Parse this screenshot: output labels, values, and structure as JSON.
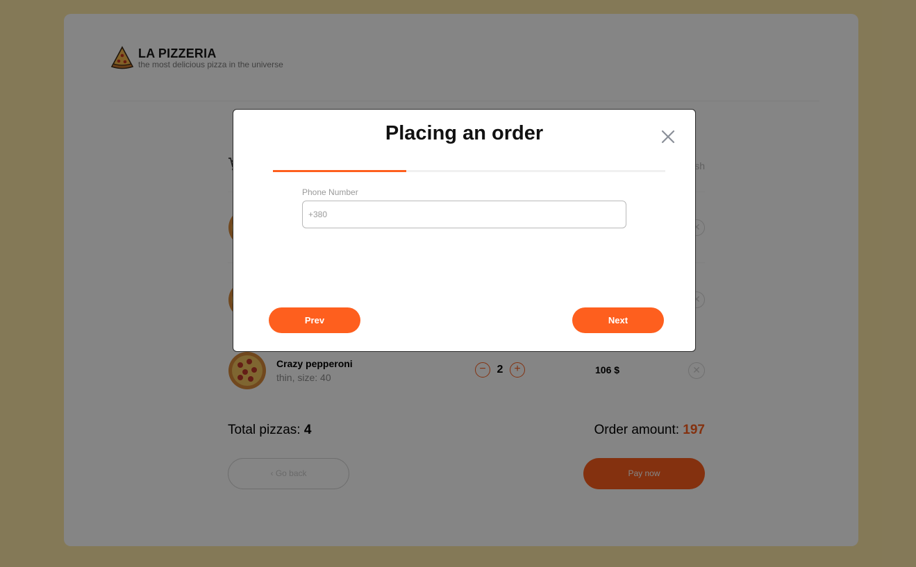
{
  "header": {
    "title": "LA PIZZERIA",
    "subtitle": "the most delicious pizza in the universe"
  },
  "cart": {
    "clear_label": "Clear trash",
    "items": [
      {
        "name": "",
        "desc": "",
        "qty": "",
        "price": ""
      },
      {
        "name": "",
        "desc": "",
        "qty": "",
        "price": ""
      },
      {
        "name": "Crazy pepperoni",
        "desc": "thin, size: 40",
        "qty": "2",
        "price": "106 $"
      }
    ],
    "total_label": "Total pizzas:",
    "total_count": "4",
    "amount_label": "Order amount:",
    "amount_value": "197",
    "back_label": "Go back",
    "pay_label": "Pay now"
  },
  "modal": {
    "title": "Placing an order",
    "progress": 0.34,
    "phone_label": "Phone Number",
    "phone_placeholder": "+380",
    "prev_label": "Prev",
    "next_label": "Next"
  },
  "colors": {
    "accent": "#fe5f1e",
    "background": "#fee8a8"
  },
  "icons": [
    "pizza-logo-icon",
    "cart-icon",
    "close-icon",
    "minus-icon",
    "plus-icon",
    "remove-icon",
    "chevron-left-icon"
  ]
}
